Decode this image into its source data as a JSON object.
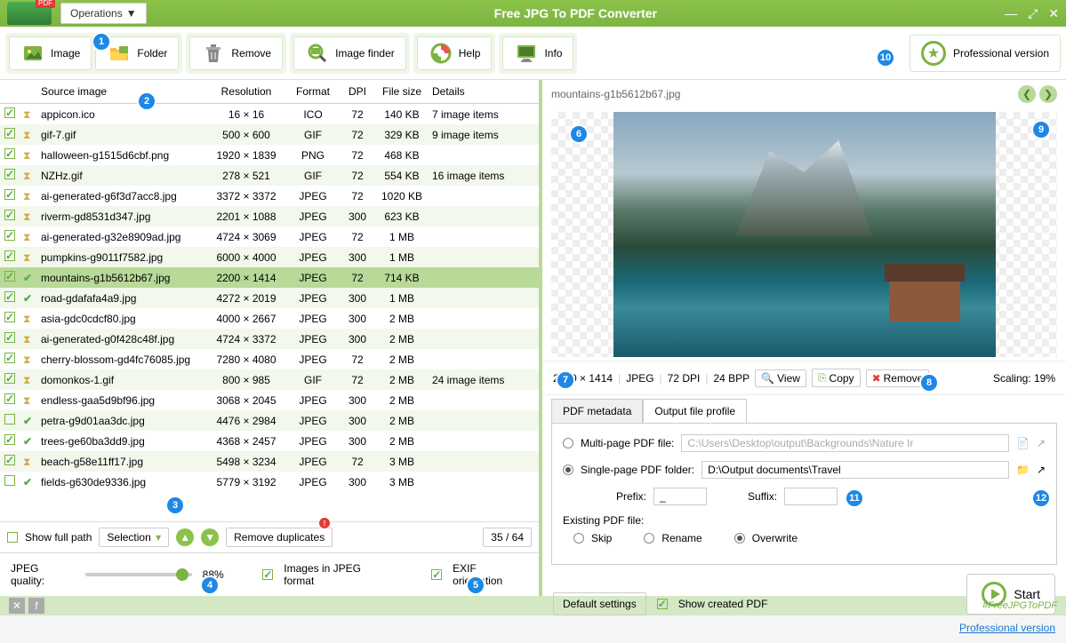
{
  "title": "Free JPG To PDF Converter",
  "operations": "Operations",
  "toolbar": {
    "image": "Image",
    "folder": "Folder",
    "remove": "Remove",
    "imageFinder": "Image finder",
    "help": "Help",
    "info": "Info",
    "pro": "Professional version"
  },
  "columns": {
    "source": "Source image",
    "resolution": "Resolution",
    "format": "Format",
    "dpi": "DPI",
    "fileSize": "File size",
    "details": "Details"
  },
  "rows": [
    {
      "checked": true,
      "status": "hourglass",
      "name": "appicon.ico",
      "res": "16 × 16",
      "fmt": "ICO",
      "dpi": "72",
      "size": "140 KB",
      "details": "7 image items"
    },
    {
      "checked": true,
      "status": "hourglass",
      "name": "gif-7.gif",
      "res": "500 × 600",
      "fmt": "GIF",
      "dpi": "72",
      "size": "329 KB",
      "details": "9 image items"
    },
    {
      "checked": true,
      "status": "hourglass",
      "name": "halloween-g1515d6cbf.png",
      "res": "1920 × 1839",
      "fmt": "PNG",
      "dpi": "72",
      "size": "468 KB",
      "details": ""
    },
    {
      "checked": true,
      "status": "hourglass",
      "name": "NZHz.gif",
      "res": "278 × 521",
      "fmt": "GIF",
      "dpi": "72",
      "size": "554 KB",
      "details": "16 image items"
    },
    {
      "checked": true,
      "status": "hourglass",
      "name": "ai-generated-g6f3d7acc8.jpg",
      "res": "3372 × 3372",
      "fmt": "JPEG",
      "dpi": "72",
      "size": "1020 KB",
      "details": ""
    },
    {
      "checked": true,
      "status": "hourglass",
      "name": "riverm-gd8531d347.jpg",
      "res": "2201 × 1088",
      "fmt": "JPEG",
      "dpi": "300",
      "size": "623 KB",
      "details": ""
    },
    {
      "checked": true,
      "status": "hourglass",
      "name": "ai-generated-g32e8909ad.jpg",
      "res": "4724 × 3069",
      "fmt": "JPEG",
      "dpi": "72",
      "size": "1 MB",
      "details": ""
    },
    {
      "checked": true,
      "status": "hourglass",
      "name": "pumpkins-g9011f7582.jpg",
      "res": "6000 × 4000",
      "fmt": "JPEG",
      "dpi": "300",
      "size": "1 MB",
      "details": ""
    },
    {
      "checked": true,
      "status": "checkmark",
      "name": "mountains-g1b5612b67.jpg",
      "res": "2200 × 1414",
      "fmt": "JPEG",
      "dpi": "72",
      "size": "714 KB",
      "details": "",
      "selected": true
    },
    {
      "checked": true,
      "status": "checkmark",
      "name": "road-gdafafa4a9.jpg",
      "res": "4272 × 2019",
      "fmt": "JPEG",
      "dpi": "300",
      "size": "1 MB",
      "details": ""
    },
    {
      "checked": true,
      "status": "hourglass",
      "name": "asia-gdc0cdcf80.jpg",
      "res": "4000 × 2667",
      "fmt": "JPEG",
      "dpi": "300",
      "size": "2 MB",
      "details": ""
    },
    {
      "checked": true,
      "status": "hourglass",
      "name": "ai-generated-g0f428c48f.jpg",
      "res": "4724 × 3372",
      "fmt": "JPEG",
      "dpi": "300",
      "size": "2 MB",
      "details": ""
    },
    {
      "checked": true,
      "status": "hourglass",
      "name": "cherry-blossom-gd4fc76085.jpg",
      "res": "7280 × 4080",
      "fmt": "JPEG",
      "dpi": "72",
      "size": "2 MB",
      "details": ""
    },
    {
      "checked": true,
      "status": "hourglass",
      "name": "domonkos-1.gif",
      "res": "800 × 985",
      "fmt": "GIF",
      "dpi": "72",
      "size": "2 MB",
      "details": "24 image items"
    },
    {
      "checked": true,
      "status": "hourglass",
      "name": "endless-gaa5d9bf96.jpg",
      "res": "3068 × 2045",
      "fmt": "JPEG",
      "dpi": "300",
      "size": "2 MB",
      "details": ""
    },
    {
      "checked": false,
      "status": "checkmark",
      "name": "petra-g9d01aa3dc.jpg",
      "res": "4476 × 2984",
      "fmt": "JPEG",
      "dpi": "300",
      "size": "2 MB",
      "details": ""
    },
    {
      "checked": true,
      "status": "checkmark",
      "name": "trees-ge60ba3dd9.jpg",
      "res": "4368 × 2457",
      "fmt": "JPEG",
      "dpi": "300",
      "size": "2 MB",
      "details": ""
    },
    {
      "checked": true,
      "status": "hourglass",
      "name": "beach-g58e11ff17.jpg",
      "res": "5498 × 3234",
      "fmt": "JPEG",
      "dpi": "72",
      "size": "3 MB",
      "details": ""
    },
    {
      "checked": false,
      "status": "checkmark",
      "name": "fields-g630de9336.jpg",
      "res": "5779 × 3192",
      "fmt": "JPEG",
      "dpi": "300",
      "size": "3 MB",
      "details": ""
    }
  ],
  "listFooter": {
    "showFullPath": "Show full path",
    "selection": "Selection",
    "removeDup": "Remove duplicates",
    "count": "35 / 64"
  },
  "quality": {
    "label": "JPEG quality:",
    "value": "88%",
    "imagesJpeg": "Images in JPEG format",
    "exif": "EXIF orientation"
  },
  "preview": {
    "filename": "mountains-g1b5612b67.jpg",
    "res": "2200 × 1414",
    "fmt": "JPEG",
    "dpi": "72 DPI",
    "bpp": "24 BPP",
    "view": "View",
    "copy": "Copy",
    "remove": "Remove",
    "scaling": "Scaling: 19%"
  },
  "tabs": {
    "meta": "PDF metadata",
    "output": "Output file profile"
  },
  "output": {
    "multiPage": "Multi-page PDF file:",
    "multiPath": "C:\\Users\\Desktop\\output\\Backgrounds\\Nature Ir",
    "singlePage": "Single-page PDF folder:",
    "singlePath": "D:\\Output documents\\Travel",
    "prefix": "Prefix:",
    "prefixVal": "_",
    "suffix": "Suffix:",
    "existing": "Existing PDF file:",
    "skip": "Skip",
    "rename": "Rename",
    "overwrite": "Overwrite"
  },
  "bottom": {
    "defaults": "Default settings",
    "showCreated": "Show created PDF",
    "pro": "Professional version",
    "start": "Start"
  },
  "footer": {
    "hashtag": "#FreeJPGToPDF"
  },
  "callouts": [
    "1",
    "2",
    "3",
    "4",
    "5",
    "6",
    "7",
    "8",
    "9",
    "10",
    "11",
    "12"
  ]
}
